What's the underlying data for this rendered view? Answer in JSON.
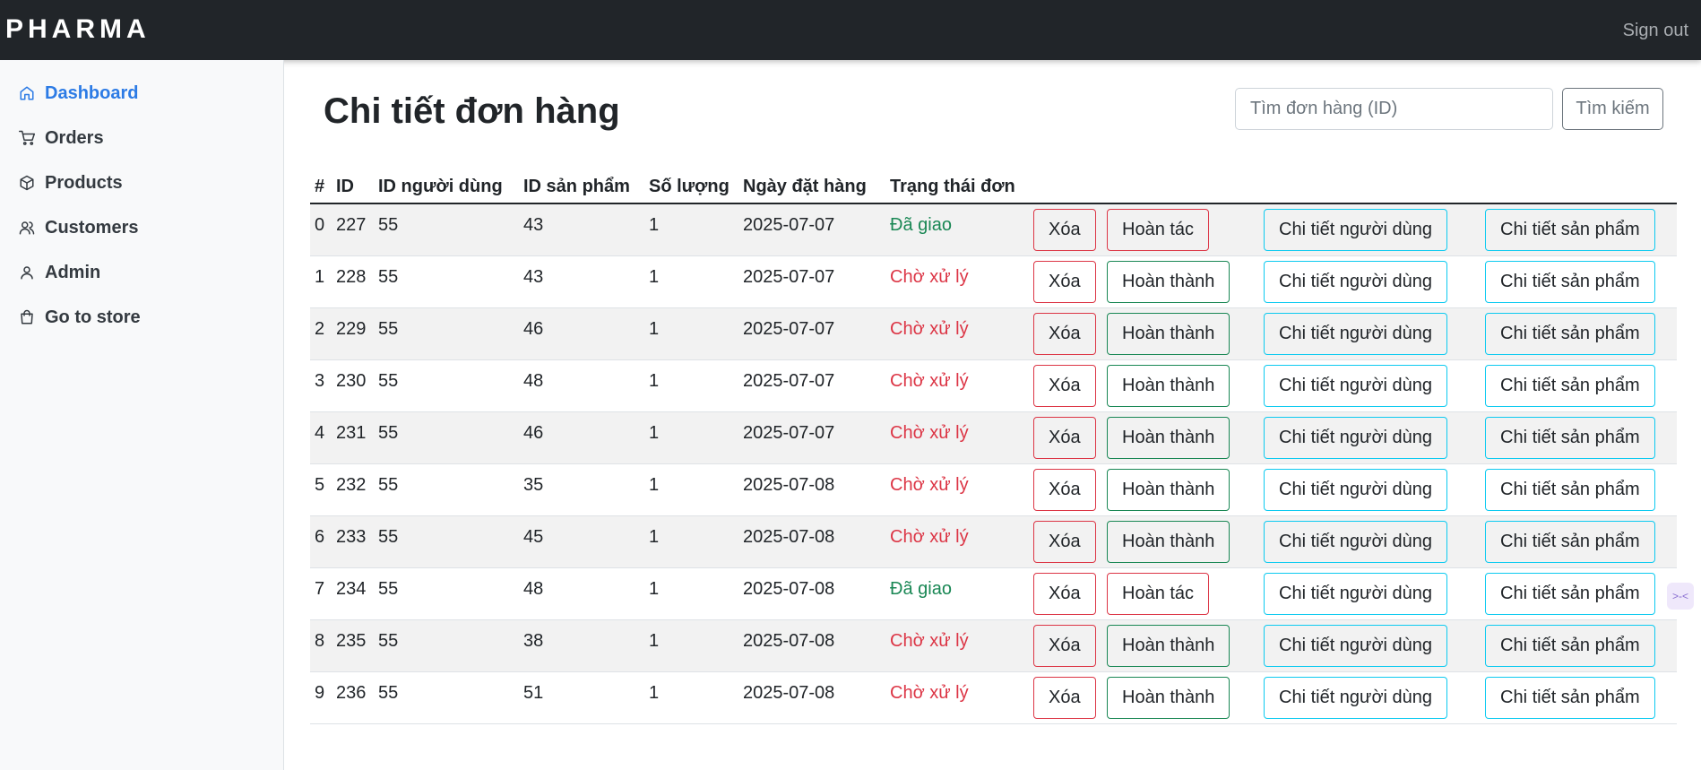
{
  "app": {
    "brand": "PHARMA",
    "sign_out": "Sign out"
  },
  "sidebar": {
    "items": [
      {
        "label": "Dashboard",
        "icon": "home-icon",
        "active": true
      },
      {
        "label": "Orders",
        "icon": "cart-icon",
        "active": false
      },
      {
        "label": "Products",
        "icon": "box-icon",
        "active": false
      },
      {
        "label": "Customers",
        "icon": "users-icon",
        "active": false
      },
      {
        "label": "Admin",
        "icon": "user-icon",
        "active": false
      },
      {
        "label": "Go to store",
        "icon": "bag-icon",
        "active": false
      }
    ]
  },
  "main": {
    "title": "Chi tiết đơn hàng",
    "search": {
      "placeholder": "Tìm đơn hàng (ID)",
      "value": "",
      "button": "Tìm kiếm"
    }
  },
  "table": {
    "headers": [
      "#",
      "ID",
      "ID người dùng",
      "ID sản phẩm",
      "Số lượng",
      "Ngày đặt hàng",
      "Trạng thái đơn"
    ],
    "buttons": {
      "delete": "Xóa",
      "undo": "Hoàn tác",
      "complete": "Hoàn thành",
      "user_detail": "Chi tiết người dùng",
      "product_detail": "Chi tiết sản phẩm"
    },
    "rows": [
      {
        "idx": "0",
        "id": "227",
        "user_id": "55",
        "product_id": "43",
        "qty": "1",
        "date": "2025-07-07",
        "status": "Đã giao",
        "delivered": true
      },
      {
        "idx": "1",
        "id": "228",
        "user_id": "55",
        "product_id": "43",
        "qty": "1",
        "date": "2025-07-07",
        "status": "Chờ xử lý",
        "delivered": false
      },
      {
        "idx": "2",
        "id": "229",
        "user_id": "55",
        "product_id": "46",
        "qty": "1",
        "date": "2025-07-07",
        "status": "Chờ xử lý",
        "delivered": false
      },
      {
        "idx": "3",
        "id": "230",
        "user_id": "55",
        "product_id": "48",
        "qty": "1",
        "date": "2025-07-07",
        "status": "Chờ xử lý",
        "delivered": false
      },
      {
        "idx": "4",
        "id": "231",
        "user_id": "55",
        "product_id": "46",
        "qty": "1",
        "date": "2025-07-07",
        "status": "Chờ xử lý",
        "delivered": false
      },
      {
        "idx": "5",
        "id": "232",
        "user_id": "55",
        "product_id": "35",
        "qty": "1",
        "date": "2025-07-08",
        "status": "Chờ xử lý",
        "delivered": false
      },
      {
        "idx": "6",
        "id": "233",
        "user_id": "55",
        "product_id": "45",
        "qty": "1",
        "date": "2025-07-08",
        "status": "Chờ xử lý",
        "delivered": false
      },
      {
        "idx": "7",
        "id": "234",
        "user_id": "55",
        "product_id": "48",
        "qty": "1",
        "date": "2025-07-08",
        "status": "Đã giao",
        "delivered": true
      },
      {
        "idx": "8",
        "id": "235",
        "user_id": "55",
        "product_id": "38",
        "qty": "1",
        "date": "2025-07-08",
        "status": "Chờ xử lý",
        "delivered": false
      },
      {
        "idx": "9",
        "id": "236",
        "user_id": "55",
        "product_id": "51",
        "qty": "1",
        "date": "2025-07-08",
        "status": "Chờ xử lý",
        "delivered": false
      }
    ]
  },
  "widget": {
    "label": ">-<",
    "icon": "extension-icon"
  }
}
